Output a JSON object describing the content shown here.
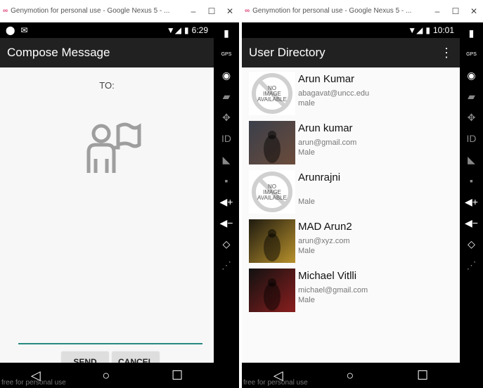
{
  "left_window": {
    "title": "Genymotion for personal use - Google Nexus 5 - ...",
    "time": "6:29",
    "app_title": "Compose Message",
    "to_label": "TO:",
    "send_label": "SEND",
    "cancel_label": "CANCEL",
    "watermark": "free for personal use"
  },
  "right_window": {
    "title": "Genymotion for personal use - Google Nexus 5 - ...",
    "time": "10:01",
    "app_title": "User Directory",
    "watermark": "free for personal use",
    "users": [
      {
        "name": "Arun Kumar",
        "email": "abagavat@uncc.edu",
        "gender": "male",
        "image": "no-image"
      },
      {
        "name": "Arun kumar",
        "email": "arun@gmail.com",
        "gender": "Male",
        "image": "game-cover-1"
      },
      {
        "name": "Arunrajni",
        "email": "",
        "gender": "Male",
        "image": "no-image"
      },
      {
        "name": "MAD Arun2",
        "email": "arun@xyz.com",
        "gender": "Male",
        "image": "game-cover-2"
      },
      {
        "name": "Michael Vitlli",
        "email": "michael@gmail.com",
        "gender": "Male",
        "image": "game-cover-3"
      }
    ]
  },
  "window_controls": {
    "minimize": "–",
    "maximize": "☐",
    "close": "✕"
  },
  "nav": {
    "back": "◁",
    "home": "○",
    "recents": "☐"
  },
  "no_image_text": [
    "NO",
    "IMAGE",
    "AVAILABLE"
  ]
}
